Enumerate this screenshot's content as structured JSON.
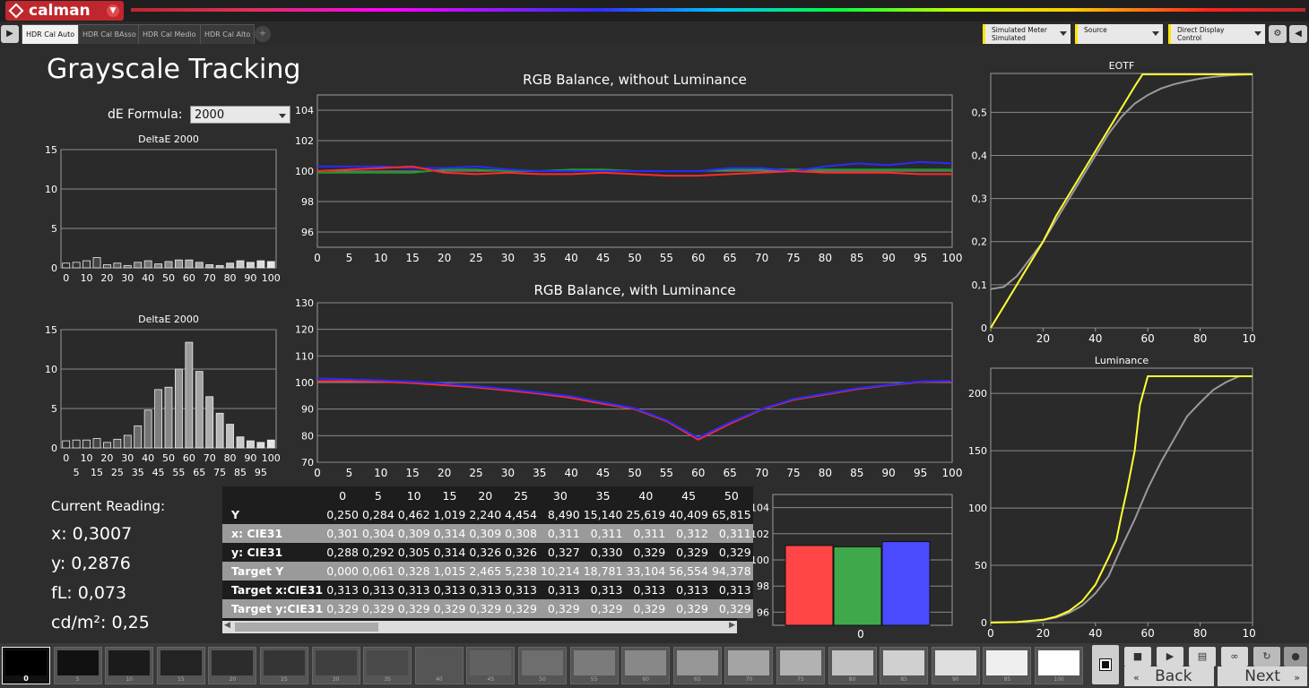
{
  "app": {
    "logo_text": "calman"
  },
  "tabs": [
    {
      "label": "HDR Cal Auto",
      "active": true
    },
    {
      "label": "HDR Cal BAsso"
    },
    {
      "label": "HDR Cal Medio"
    },
    {
      "label": "HDR Cal Alto"
    }
  ],
  "toolbar": {
    "meter": {
      "line1": "Simulated Meter",
      "line2": "Simulated"
    },
    "source": {
      "line1": "Source"
    },
    "display": {
      "line1": "Direct Display Control"
    },
    "settings_icon": "gear-icon",
    "collapse_icon": "chevron-left-icon",
    "nav_icon": "play-icon",
    "add_tab_icon": "plus-icon"
  },
  "page": {
    "title": "Grayscale Tracking",
    "de_formula_label": "dE Formula:",
    "de_formula_value": "2000"
  },
  "colors": {
    "red": "#ff2a2a",
    "green": "#1f9a2a",
    "blue": "#2a2aff",
    "yellow": "#ffff33",
    "gray": "#9a9a9a",
    "accent": "#c0272d"
  },
  "chart_data": [
    {
      "type": "bar",
      "title": "DeltaE 2000",
      "ylim": [
        0,
        15
      ],
      "yticks": [
        0,
        5,
        10,
        15
      ],
      "categories": [
        0,
        5,
        10,
        15,
        20,
        25,
        30,
        35,
        40,
        45,
        50,
        55,
        60,
        65,
        70,
        75,
        80,
        85,
        90,
        95,
        100
      ],
      "xtick_top": [
        "0",
        "10",
        "20",
        "30",
        "40",
        "50",
        "60",
        "70",
        "80",
        "90",
        "100"
      ],
      "xtick_bottom": [
        "5",
        "15",
        "25",
        "35",
        "45",
        "55",
        "65",
        "75",
        "85",
        "95"
      ],
      "values": [
        0.6,
        0.7,
        0.9,
        1.3,
        0.4,
        0.6,
        0.3,
        0.7,
        0.9,
        0.5,
        0.8,
        1.0,
        1.0,
        0.7,
        0.4,
        0.3,
        0.6,
        0.9,
        0.7,
        0.9,
        0.8
      ]
    },
    {
      "type": "bar",
      "title": "DeltaE 2000",
      "ylim": [
        0,
        15
      ],
      "yticks": [
        0,
        5,
        10,
        15
      ],
      "categories": [
        0,
        5,
        10,
        15,
        20,
        25,
        30,
        35,
        40,
        45,
        50,
        55,
        60,
        65,
        70,
        75,
        80,
        85,
        90,
        95,
        100
      ],
      "xtick_top": [
        "0",
        "10",
        "20",
        "30",
        "40",
        "50",
        "60",
        "70",
        "80",
        "90",
        "100"
      ],
      "xtick_bottom": [
        "5",
        "15",
        "25",
        "35",
        "45",
        "55",
        "65",
        "75",
        "85",
        "95"
      ],
      "values": [
        0.9,
        1.0,
        1.0,
        1.2,
        0.7,
        1.1,
        1.6,
        2.8,
        4.8,
        7.4,
        7.7,
        10.0,
        13.4,
        9.7,
        6.5,
        4.4,
        3.0,
        1.4,
        0.9,
        0.7,
        1.0
      ]
    },
    {
      "type": "line",
      "title": "RGB Balance, without Luminance",
      "ylim": [
        95,
        105
      ],
      "yticks": [
        96,
        98,
        100,
        102,
        104
      ],
      "x": [
        0,
        5,
        10,
        15,
        20,
        25,
        30,
        35,
        40,
        45,
        50,
        55,
        60,
        65,
        70,
        75,
        80,
        85,
        90,
        95,
        100
      ],
      "series": [
        {
          "color_key": "green",
          "values": [
            99.9,
            99.9,
            99.9,
            99.9,
            100.1,
            100.1,
            100.0,
            100.0,
            100.1,
            100.1,
            100.0,
            100.0,
            100.0,
            100.1,
            100.1,
            100.1,
            100.1,
            100.1,
            100.1,
            100.1,
            100.1
          ]
        },
        {
          "color_key": "blue",
          "values": [
            100.3,
            100.3,
            100.3,
            100.2,
            100.2,
            100.3,
            100.1,
            100.0,
            100.0,
            100.0,
            100.0,
            100.0,
            100.0,
            100.2,
            100.2,
            100.0,
            100.3,
            100.5,
            100.4,
            100.6,
            100.5
          ]
        },
        {
          "color_key": "red",
          "values": [
            100.0,
            100.1,
            100.2,
            100.3,
            99.9,
            99.8,
            99.9,
            99.8,
            99.8,
            99.9,
            99.8,
            99.7,
            99.7,
            99.8,
            99.9,
            100.0,
            99.9,
            99.9,
            99.9,
            99.8,
            99.8
          ]
        }
      ]
    },
    {
      "type": "line",
      "title": "RGB Balance, with Luminance",
      "ylim": [
        70,
        130
      ],
      "yticks": [
        70,
        80,
        90,
        100,
        110,
        120,
        130
      ],
      "x": [
        0,
        5,
        10,
        15,
        20,
        25,
        30,
        35,
        40,
        45,
        50,
        55,
        60,
        65,
        70,
        75,
        80,
        85,
        90,
        95,
        100
      ],
      "series": [
        {
          "color_key": "red",
          "values": [
            100.5,
            100.5,
            100.3,
            99.8,
            99.0,
            98.2,
            97.0,
            95.8,
            94.2,
            92.0,
            90.0,
            85.5,
            78.5,
            84.5,
            89.8,
            93.5,
            95.5,
            97.5,
            99.0,
            100.2,
            100.4
          ]
        },
        {
          "color_key": "blue",
          "values": [
            101.5,
            101.2,
            100.8,
            100.3,
            99.6,
            98.6,
            97.5,
            96.2,
            94.8,
            92.5,
            90.3,
            85.8,
            79.2,
            85.0,
            90.0,
            93.8,
            95.8,
            97.8,
            99.1,
            100.4,
            100.6
          ]
        }
      ]
    },
    {
      "type": "line",
      "title": "EOTF",
      "xlim": [
        0,
        100
      ],
      "ylim": [
        0,
        0.59
      ],
      "yticks": [
        0,
        0.1,
        0.2,
        0.3,
        0.4,
        0.5
      ],
      "ytick_labels": [
        "0",
        "0,1",
        "0,2",
        "0,3",
        "0,4",
        "0,5"
      ],
      "xticks": [
        0,
        20,
        40,
        60,
        80,
        100
      ],
      "series": [
        {
          "color_key": "gray",
          "x": [
            0,
            5,
            10,
            15,
            20,
            25,
            30,
            35,
            40,
            45,
            50,
            55,
            60,
            65,
            70,
            75,
            80,
            85,
            90,
            95,
            100
          ],
          "values": [
            0.09,
            0.095,
            0.12,
            0.16,
            0.2,
            0.25,
            0.3,
            0.35,
            0.4,
            0.45,
            0.49,
            0.52,
            0.54,
            0.555,
            0.565,
            0.572,
            0.578,
            0.582,
            0.585,
            0.587,
            0.588
          ]
        },
        {
          "color_key": "yellow",
          "x": [
            0,
            5,
            10,
            15,
            20,
            25,
            30,
            35,
            40,
            45,
            50,
            55,
            58,
            60,
            100
          ],
          "values": [
            0,
            0.05,
            0.1,
            0.15,
            0.2,
            0.26,
            0.31,
            0.36,
            0.41,
            0.46,
            0.51,
            0.56,
            0.588,
            0.588,
            0.588
          ]
        }
      ]
    },
    {
      "type": "line",
      "title": "Luminance",
      "xlim": [
        0,
        100
      ],
      "ylim": [
        0,
        222
      ],
      "yticks": [
        0,
        50,
        100,
        150,
        200
      ],
      "xticks": [
        0,
        20,
        40,
        60,
        80,
        100
      ],
      "series": [
        {
          "color_key": "gray",
          "x": [
            0,
            10,
            20,
            25,
            30,
            35,
            40,
            45,
            50,
            55,
            60,
            65,
            70,
            75,
            80,
            85,
            90,
            95,
            100
          ],
          "values": [
            0.3,
            0.5,
            2.2,
            4.5,
            8.5,
            15,
            25.5,
            40.4,
            66,
            90,
            117,
            140,
            160,
            180,
            192,
            203,
            210,
            215,
            215
          ]
        },
        {
          "color_key": "yellow",
          "x": [
            0,
            10,
            20,
            25,
            30,
            35,
            40,
            45,
            48,
            50,
            52,
            55,
            57,
            60,
            100
          ],
          "values": [
            0,
            0.5,
            2.5,
            5.2,
            10.2,
            18.8,
            33.1,
            56.6,
            72,
            94.4,
            115,
            150,
            190,
            215,
            215
          ]
        }
      ]
    },
    {
      "type": "bar",
      "title": "",
      "ylim": [
        95,
        105
      ],
      "yticks": [
        96,
        98,
        100,
        102,
        104
      ],
      "categories": [
        "0"
      ],
      "series": [
        {
          "color_key": "red",
          "values": [
            101.1
          ]
        },
        {
          "color_key": "green",
          "values": [
            101.0
          ]
        },
        {
          "color_key": "blue",
          "values": [
            101.4
          ]
        }
      ]
    }
  ],
  "current_reading": {
    "title": "Current Reading:",
    "x": "x: 0,3007",
    "y": "y: 0,2876",
    "fl": "fL: 0,073",
    "cd": "cd/m²: 0,25"
  },
  "table": {
    "columns": [
      "0",
      "5",
      "10",
      "15",
      "20",
      "25",
      "30",
      "35",
      "40",
      "45",
      "50"
    ],
    "rows": [
      {
        "label": "Y",
        "values": [
          "0,250",
          "0,284",
          "0,462",
          "1,019",
          "2,240",
          "4,454",
          "8,490",
          "15,140",
          "25,619",
          "40,409",
          "65,815"
        ]
      },
      {
        "label": "x: CIE31",
        "values": [
          "0,301",
          "0,304",
          "0,309",
          "0,314",
          "0,309",
          "0,308",
          "0,311",
          "0,311",
          "0,311",
          "0,312",
          "0,311"
        ]
      },
      {
        "label": "y: CIE31",
        "values": [
          "0,288",
          "0,292",
          "0,305",
          "0,314",
          "0,326",
          "0,326",
          "0,327",
          "0,330",
          "0,329",
          "0,329",
          "0,329"
        ]
      },
      {
        "label": "Target Y",
        "values": [
          "0,000",
          "0,061",
          "0,328",
          "1,015",
          "2,465",
          "5,238",
          "10,214",
          "18,781",
          "33,104",
          "56,554",
          "94,378"
        ]
      },
      {
        "label": "Target x:CIE31",
        "values": [
          "0,313",
          "0,313",
          "0,313",
          "0,313",
          "0,313",
          "0,313",
          "0,313",
          "0,313",
          "0,313",
          "0,313",
          "0,313"
        ]
      },
      {
        "label": "Target y:CIE31",
        "values": [
          "0,329",
          "0,329",
          "0,329",
          "0,329",
          "0,329",
          "0,329",
          "0,329",
          "0,329",
          "0,329",
          "0,329",
          "0,329"
        ]
      }
    ]
  },
  "patches": [
    {
      "label": "0",
      "color": "#000000",
      "selected": true
    },
    {
      "label": "5",
      "color": "#111111"
    },
    {
      "label": "10",
      "color": "#1b1b1b"
    },
    {
      "label": "15",
      "color": "#232323"
    },
    {
      "label": "20",
      "color": "#2c2c2c"
    },
    {
      "label": "25",
      "color": "#353535"
    },
    {
      "label": "30",
      "color": "#3f3f3f"
    },
    {
      "label": "35",
      "color": "#4a4a4a"
    },
    {
      "label": "40",
      "color": "#555555"
    },
    {
      "label": "45",
      "color": "#616161"
    },
    {
      "label": "50",
      "color": "#6e6e6e"
    },
    {
      "label": "55",
      "color": "#7b7b7b"
    },
    {
      "label": "60",
      "color": "#888888"
    },
    {
      "label": "65",
      "color": "#969696"
    },
    {
      "label": "70",
      "color": "#a4a4a4"
    },
    {
      "label": "75",
      "color": "#b2b2b2"
    },
    {
      "label": "80",
      "color": "#c1c1c1"
    },
    {
      "label": "85",
      "color": "#d0d0d0"
    },
    {
      "label": "90",
      "color": "#dfdfdf"
    },
    {
      "label": "95",
      "color": "#efefef"
    },
    {
      "label": "100",
      "color": "#ffffff"
    }
  ],
  "controls": {
    "back_label": "Back",
    "next_label": "Next",
    "icons": [
      "stop-icon",
      "play-icon",
      "save-icon",
      "loop-icon",
      "refresh-icon",
      "record-icon"
    ]
  }
}
